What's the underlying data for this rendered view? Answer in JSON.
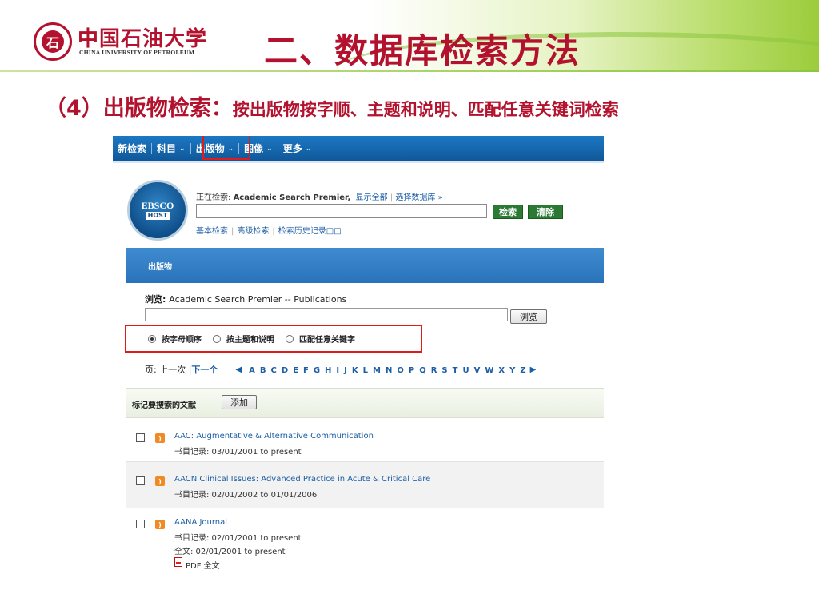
{
  "slide": {
    "logo_cn": "中国石油大学",
    "logo_en": "CHINA UNIVERSITY OF PETROLEUM",
    "seal_glyph": "石",
    "title": "二、数据库检索方法",
    "subtitle_main": "（4）出版物检索：",
    "subtitle_detail": "按出版物按字顺、主题和说明、匹配任意关键词检索"
  },
  "navbar": {
    "items": [
      {
        "label": "新检索",
        "caret": ""
      },
      {
        "label": "科目",
        "caret": "⌄"
      },
      {
        "label": "出版物",
        "caret": "⌄"
      },
      {
        "label": "图像",
        "caret": "⌄"
      },
      {
        "label": "更多",
        "caret": "⌄"
      }
    ]
  },
  "ebsco": {
    "logo_top": "EBSCO",
    "logo_bottom": "HOST",
    "searching_prefix": "正在检索: ",
    "database": "Academic Search Premier,",
    "show_all": "显示全部",
    "choose_db": "选择数据库 »",
    "search_value": "",
    "search_button": "检索",
    "clear_button": "清除",
    "links": [
      "基本检索",
      "高级检索",
      "检索历史记录□□"
    ]
  },
  "publications": {
    "header": "出版物",
    "browse_prefix": "浏览: ",
    "browse_target": "Academic Search Premier -- Publications",
    "browse_value": "",
    "browse_button": "浏览",
    "radios": [
      {
        "label": "按字母顺序",
        "selected": true
      },
      {
        "label": "按主题和说明",
        "selected": false
      },
      {
        "label": "匹配任意关键字",
        "selected": false
      }
    ],
    "pager_prefix": "页: 上一次 | ",
    "pager_next": "下一个",
    "letters": [
      "A",
      "B",
      "C",
      "D",
      "E",
      "F",
      "G",
      "H",
      "I",
      "J",
      "K",
      "L",
      "M",
      "N",
      "O",
      "P",
      "Q",
      "R",
      "S",
      "T",
      "U",
      "V",
      "W",
      "X",
      "Y",
      "Z"
    ],
    "mark_label": "标记要搜索的文献",
    "add_button": "添加",
    "results": [
      {
        "title": "AAC: Augmentative & Alternative Communication",
        "meta1": "书目记录: 03/01/2001 to present"
      },
      {
        "title": "AACN Clinical Issues: Advanced Practice in Acute & Critical Care",
        "meta1": "书目记录: 02/01/2002 to 01/01/2006"
      },
      {
        "title": "AANA Journal",
        "meta1": "书目记录: 02/01/2001 to present",
        "meta2": "全文: 02/01/2001 to present",
        "pdf": "PDF 全文"
      }
    ]
  },
  "colors": {
    "brand_red": "#b3122e",
    "nav_blue": "#1c78c3",
    "link_blue": "#1c5ea5",
    "highlight_red": "#e01b1b",
    "green_button": "#2b7a33"
  }
}
